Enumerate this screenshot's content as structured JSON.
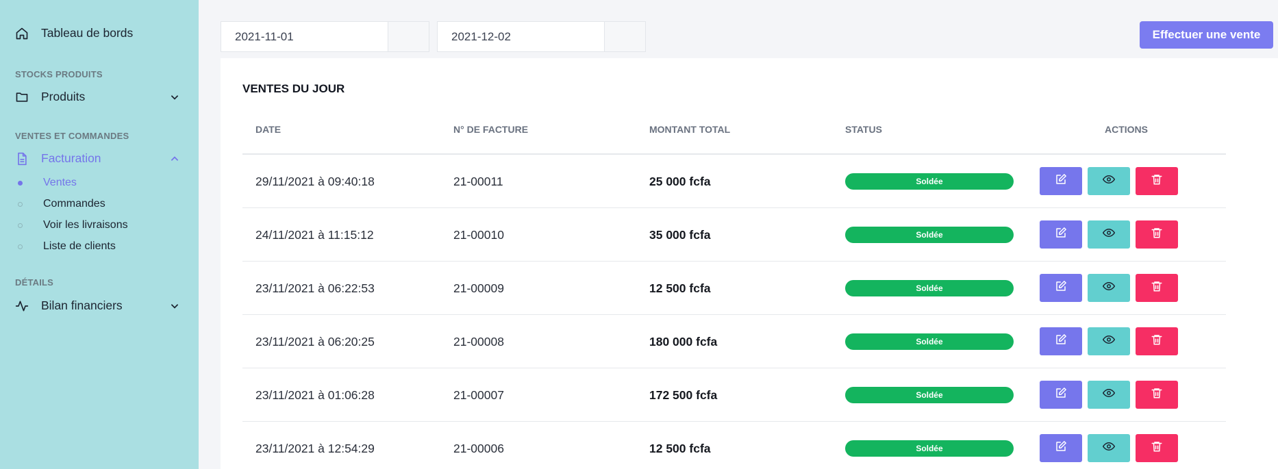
{
  "sidebar": {
    "dashboard": {
      "label": "Tableau de bords",
      "icon": "home-icon"
    },
    "sections": [
      {
        "title": "STOCKS PRODUITS"
      },
      {
        "title": "VENTES ET COMMANDES"
      },
      {
        "title": "DÉTAILS"
      }
    ],
    "produits": {
      "label": "Produits",
      "icon": "folder-icon"
    },
    "facturation": {
      "label": "Facturation",
      "icon": "file-icon"
    },
    "subitems": [
      {
        "label": "Ventes",
        "active": true
      },
      {
        "label": "Commandes"
      },
      {
        "label": "Voir les livraisons"
      },
      {
        "label": "Liste de clients"
      }
    ],
    "bilan": {
      "label": "Bilan financiers",
      "icon": "activity-icon"
    }
  },
  "filters": {
    "start_date": "2021-11-01",
    "end_date": "2021-12-02"
  },
  "action_button": {
    "label": "Effectuer une vente"
  },
  "card": {
    "title": "VENTES DU JOUR"
  },
  "table": {
    "headers": [
      "DATE",
      "N° DE FACTURE",
      "MONTANT TOTAL",
      "STATUS",
      "ACTIONS"
    ],
    "rows": [
      {
        "date": "29/11/2021 à 09:40:18",
        "invoice": "21-00011",
        "amount": "25 000 fcfa",
        "status": "Soldée"
      },
      {
        "date": "24/11/2021 à 11:15:12",
        "invoice": "21-00010",
        "amount": "35 000 fcfa",
        "status": "Soldée"
      },
      {
        "date": "23/11/2021 à 06:22:53",
        "invoice": "21-00009",
        "amount": "12 500 fcfa",
        "status": "Soldée"
      },
      {
        "date": "23/11/2021 à 06:20:25",
        "invoice": "21-00008",
        "amount": "180 000 fcfa",
        "status": "Soldée"
      },
      {
        "date": "23/11/2021 à 01:06:28",
        "invoice": "21-00007",
        "amount": "172 500 fcfa",
        "status": "Soldée"
      },
      {
        "date": "23/11/2021 à 12:54:29",
        "invoice": "21-00006",
        "amount": "12 500 fcfa",
        "status": "Soldée"
      }
    ],
    "action_icons": [
      "edit-icon",
      "eye-icon",
      "trash-icon"
    ]
  },
  "colors": {
    "sidebar_bg": "#aadfe2",
    "accent": "#7575ea",
    "status_green": "#14b45e",
    "view_teal": "#62cfcf",
    "delete_red": "#f62e64"
  }
}
